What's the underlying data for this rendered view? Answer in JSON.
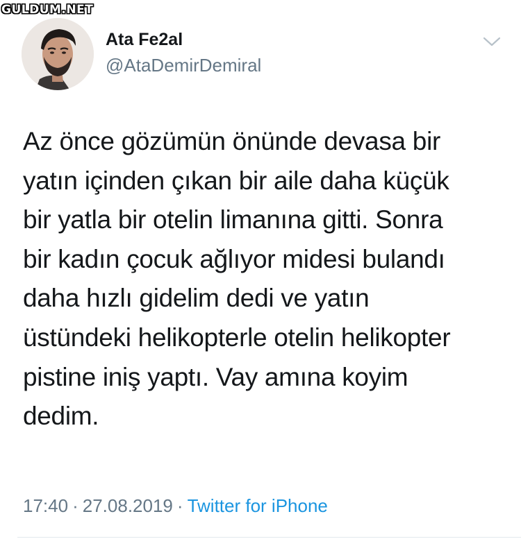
{
  "watermark": {
    "text": "GULDUM.NET"
  },
  "tweet": {
    "author": {
      "name": "Ata Fe2al",
      "handle": "@AtaDemirDemiral",
      "avatar_icon": "profile-photo"
    },
    "menu_icon": "chevron-down-icon",
    "text": "Az önce gözümün önünde devasa bir\nyatın içinden çıkan bir aile daha küçük\nbir yatla bir otelin limanına gitti. Sonra\nbir kadın çocuk ağlıyor midesi bulandı\ndaha hızlı gidelim dedi ve yatın\nüstündeki helikopterle otelin helikopter\npistine iniş yaptı. Vay amına koyim\ndedim.",
    "time": "17:40",
    "date": "27.08.2019",
    "separator": "·",
    "source": "Twitter for iPhone"
  },
  "colors": {
    "text": "#14171a",
    "secondary": "#657786",
    "link": "#1b95e0",
    "divider": "#e1e8ed"
  }
}
